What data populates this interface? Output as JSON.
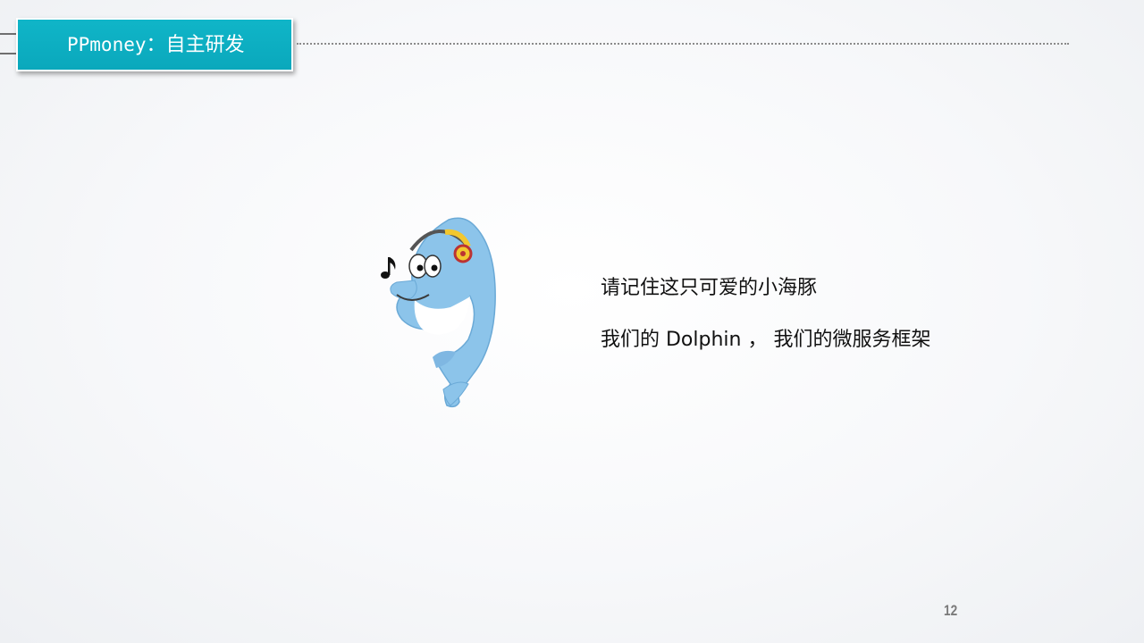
{
  "header": {
    "title_latin": "PPmoney",
    "title_rest": "：自主研发"
  },
  "content": {
    "line1": "请记住这只可爱的小海豚",
    "line2": "我们的 Dolphin ， 我们的微服务框架"
  },
  "footer": {
    "page_number": "12"
  },
  "icons": {
    "mascot": "dolphin-with-headphones",
    "note": "music-note-icon"
  },
  "colors": {
    "accent": "#0aa8bc",
    "dolphin": "#8cc4ea",
    "headphone": "#f2c72e"
  }
}
